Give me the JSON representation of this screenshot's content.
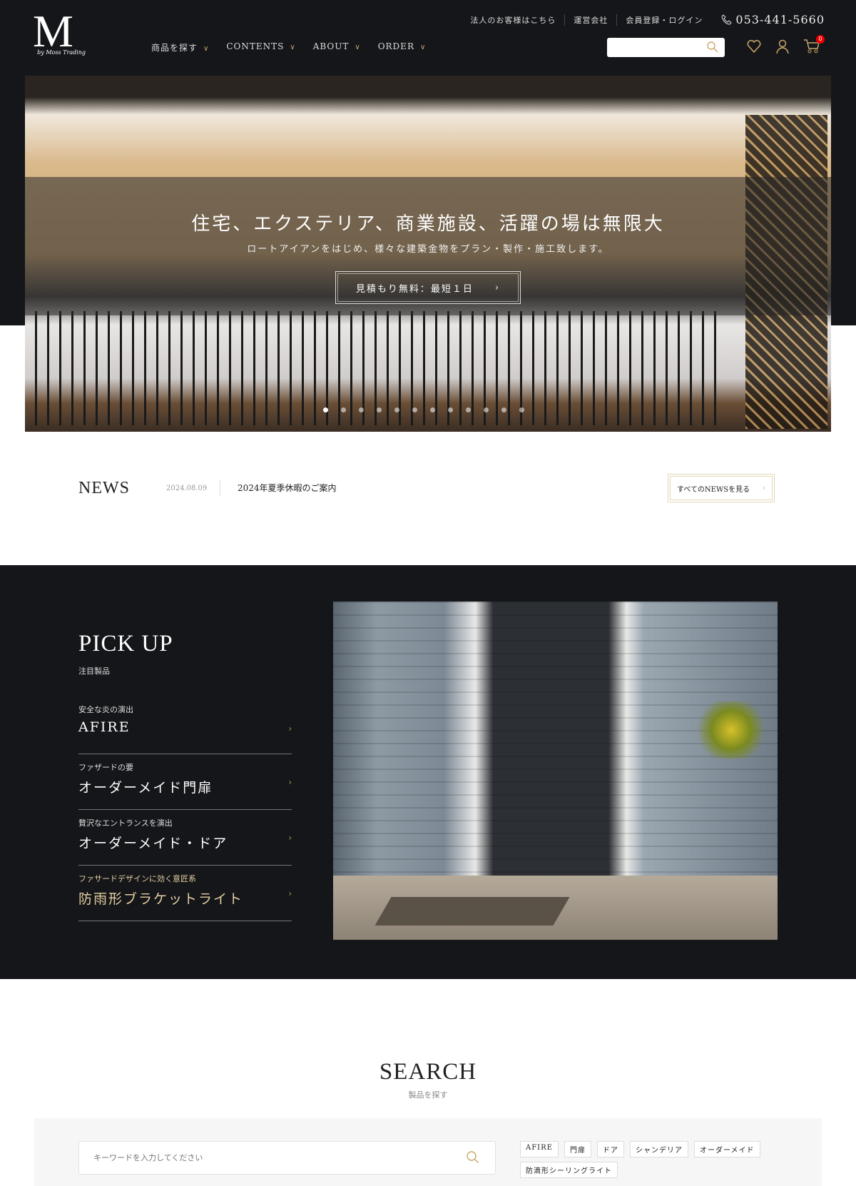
{
  "header": {
    "logo": "M",
    "logo_sub": "by Moss Trading",
    "util_links": [
      "法人のお客様はこちら",
      "運営会社",
      "会員登録・ログイン"
    ],
    "phone": "053-441-5660",
    "nav": [
      "商品を探す",
      "CONTENTS",
      "ABOUT",
      "ORDER"
    ],
    "search_placeholder": "",
    "cart_count": "0"
  },
  "hero": {
    "title": "住宅、エクステリア、商業施設、活躍の場は無限大",
    "subtitle": "ロートアイアンをはじめ、様々な建築金物をプラン・製作・施工致します。",
    "cta": "見積もり無料：最短１日",
    "slides": 12,
    "active_slide": 1
  },
  "news": {
    "heading": "NEWS",
    "date": "2024.08.09",
    "title": "2024年夏季休暇のご案内",
    "all_label": "すべてのNEWSを見る"
  },
  "pickup": {
    "heading": "PICK UP",
    "sub": "注目製品",
    "items": [
      {
        "sub": "安全な炎の演出",
        "title": "AFIRE"
      },
      {
        "sub": "ファザードの要",
        "title": "オーダーメイド門扉"
      },
      {
        "sub": "贅沢なエントランスを演出",
        "title": "オーダーメイド・ドア"
      },
      {
        "sub": "ファサードデザインに効く意匠系",
        "title": "防雨形ブラケットライト"
      }
    ]
  },
  "search": {
    "heading": "SEARCH",
    "sub": "製品を探す",
    "placeholder": "キーワードを入力してください",
    "tags": [
      "AFIRE",
      "門扉",
      "ドア",
      "シャンデリア",
      "オーダーメイド",
      "防滴形シーリングライト"
    ]
  },
  "colors": {
    "dark": "#15161a",
    "gold": "#c9a86a",
    "badge": "#e00000"
  }
}
